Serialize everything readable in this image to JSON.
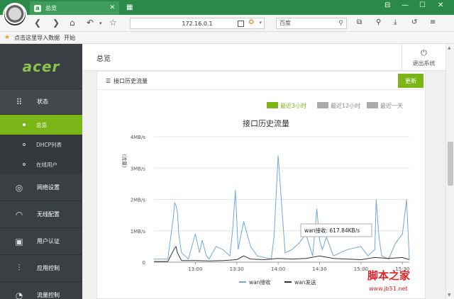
{
  "browser": {
    "tab_title": "总览",
    "tab_icon": "a",
    "address": "172.16.0.1",
    "search_placeholder": "百度",
    "bookmarks": [
      "点击这里导入数据",
      "开始"
    ]
  },
  "sidebar": {
    "logo": "acer",
    "items": [
      {
        "label": "状态",
        "icon": "grid-icon"
      },
      {
        "label": "网络设置",
        "icon": "globe-icon"
      },
      {
        "label": "无线配置",
        "icon": "wifi-icon"
      },
      {
        "label": "用户认证",
        "icon": "id-card-icon"
      },
      {
        "label": "应用控制",
        "icon": "sliders-icon"
      },
      {
        "label": "流量控制",
        "icon": "gauge-icon"
      }
    ],
    "sub_items": [
      {
        "label": "总览",
        "active": true
      },
      {
        "label": "DHCP列表",
        "active": false
      },
      {
        "label": "在线用户",
        "active": false
      }
    ]
  },
  "header": {
    "title": "总览",
    "logout_label": "退出系统"
  },
  "panel": {
    "title": "接口历史流量",
    "refresh_label": "更新",
    "range_buttons": [
      {
        "label": "最近3小时",
        "active": true
      },
      {
        "label": "最近12小时",
        "active": false
      },
      {
        "label": "最近一天",
        "active": false
      }
    ]
  },
  "chart_data": {
    "type": "line",
    "title": "接口历史流量",
    "ylabel": "(流量)",
    "y_ticks": [
      "0",
      "1MB/s",
      "2MB/s",
      "3MB/s",
      "4MB/s"
    ],
    "x_ticks": [
      "13:00",
      "13:30",
      "14:00",
      "14:30",
      "15:00",
      "15:30"
    ],
    "ylim": [
      0,
      4
    ],
    "xlim": [
      "12:30",
      "15:35"
    ],
    "legend_position": "bottom",
    "tooltip": {
      "series": "wan接收",
      "value": "617.84KB/s"
    },
    "series": [
      {
        "name": "wan接收",
        "color": "#6fa8dc",
        "x": [
          "12:30",
          "12:40",
          "12:44",
          "12:45",
          "12:46",
          "12:47",
          "12:48",
          "12:50",
          "12:55",
          "13:00",
          "13:03",
          "13:05",
          "13:08",
          "13:10",
          "13:15",
          "13:20",
          "13:25",
          "13:27",
          "13:29",
          "13:31",
          "13:35",
          "13:40",
          "13:45",
          "13:55",
          "13:57",
          "14:00",
          "14:05",
          "14:10",
          "14:15",
          "14:20",
          "14:25",
          "14:28",
          "14:30",
          "14:32",
          "14:35",
          "14:40",
          "14:45",
          "14:50",
          "15:00",
          "15:05",
          "15:10",
          "15:11",
          "15:13",
          "15:15",
          "15:20",
          "15:25",
          "15:30",
          "15:33",
          "15:35"
        ],
        "values": [
          0.1,
          0.1,
          1.4,
          1.9,
          1.8,
          1.6,
          0.9,
          0.3,
          0.1,
          0.9,
          0.3,
          0.7,
          0.2,
          0.1,
          0.5,
          0.4,
          0.2,
          1.0,
          2.3,
          0.4,
          1.3,
          0.5,
          0.2,
          0.1,
          0.8,
          3.4,
          0.3,
          0.4,
          0.6,
          0.9,
          0.2,
          1.7,
          0.7,
          0.4,
          0.8,
          0.2,
          0.3,
          0.4,
          0.5,
          0.2,
          0.4,
          2.0,
          0.8,
          0.2,
          0.1,
          0.6,
          0.9,
          2.0,
          0.1
        ]
      },
      {
        "name": "wan发送",
        "color": "#333333",
        "x": [
          "12:30",
          "12:40",
          "12:45",
          "12:46",
          "12:47",
          "12:50",
          "13:00",
          "13:10",
          "13:20",
          "13:30",
          "13:35",
          "13:40",
          "13:50",
          "14:00",
          "14:10",
          "14:20",
          "14:30",
          "14:40",
          "14:50",
          "15:00",
          "15:10",
          "15:20",
          "15:30",
          "15:35"
        ],
        "values": [
          0.02,
          0.02,
          0.45,
          0.5,
          0.3,
          0.05,
          0.05,
          0.04,
          0.05,
          0.08,
          0.2,
          0.1,
          0.08,
          0.12,
          0.1,
          0.12,
          0.2,
          0.12,
          0.1,
          0.08,
          0.15,
          0.12,
          0.15,
          0.08
        ]
      }
    ]
  }
}
